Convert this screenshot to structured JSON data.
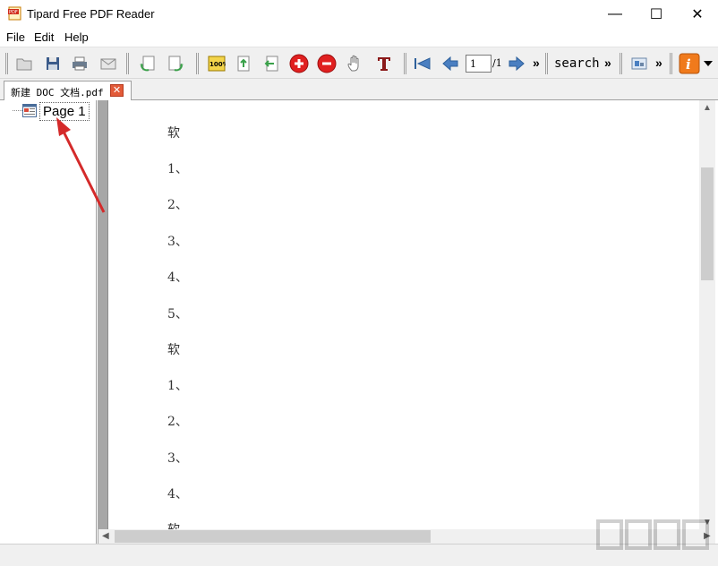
{
  "window": {
    "title": "Tipard Free PDF Reader",
    "controls": {
      "minimize": "—",
      "maximize": "☐",
      "close": "✕"
    }
  },
  "menu": {
    "items": [
      {
        "label": "File"
      },
      {
        "label": "Edit"
      },
      {
        "label": "Help"
      }
    ]
  },
  "toolbar": {
    "page_input": "1",
    "page_total": "/1",
    "search_label": "search",
    "overflow_label": "»",
    "zoom_100_label": "100%",
    "icons": [
      "open-file-icon",
      "save-icon",
      "print-icon",
      "email-icon",
      "rotate-left-icon",
      "rotate-right-icon",
      "actual-size-icon",
      "fit-width-icon",
      "fit-page-icon",
      "zoom-in-icon",
      "zoom-out-icon",
      "hand-tool-icon",
      "text-select-icon",
      "first-page-icon",
      "previous-page-icon",
      "next-page-icon",
      "snapshot-icon",
      "info-icon"
    ],
    "colors": {
      "zoom": "#e02020",
      "info": "#f07a1c",
      "text_tool": "#8b1a1a"
    }
  },
  "tabs": [
    {
      "label": "新建 DOC 文档.pdf",
      "close_glyph": "✕"
    }
  ],
  "sidebar": {
    "items": [
      {
        "label": "Page 1"
      }
    ]
  },
  "document": {
    "lines": [
      "软",
      "1、",
      "2、",
      "3、",
      "4、",
      "5、",
      "软",
      "1、",
      "2、",
      "3、",
      "4、",
      "软"
    ]
  },
  "scrollbar": {
    "up": "▲",
    "down": "▼",
    "left": "◀",
    "right": "▶"
  },
  "annotation": {
    "arrow_color": "#d42a2a"
  }
}
